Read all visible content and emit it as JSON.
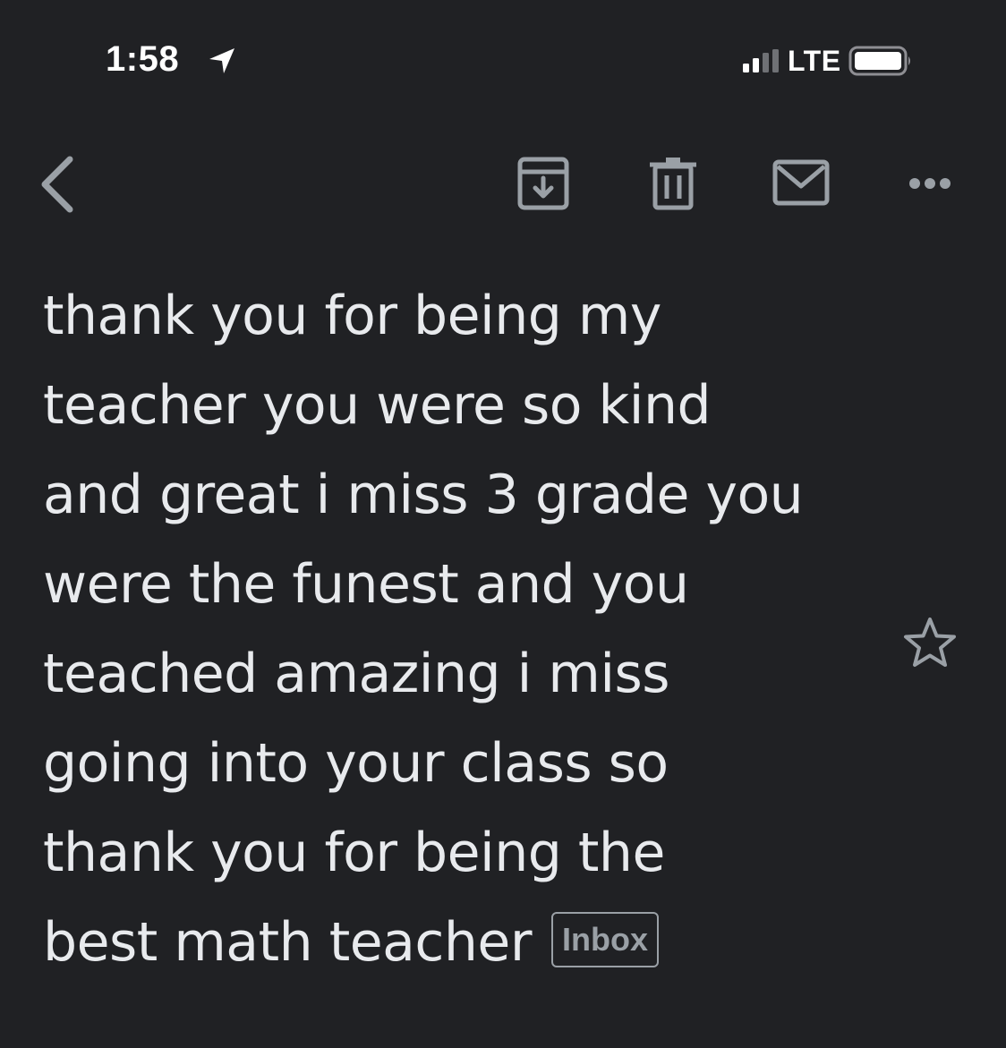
{
  "status_bar": {
    "time": "1:58",
    "network": "LTE",
    "icons": [
      "location-arrow-icon",
      "signal-bars-icon",
      "battery-icon"
    ]
  },
  "toolbar": {
    "icons": [
      "back-chevron-icon",
      "archive-icon",
      "trash-icon",
      "mail-icon",
      "more-dots-icon"
    ]
  },
  "message": {
    "lines": [
      "thank you for being my",
      "teacher you were so kind",
      "and great i miss 3 grade you",
      "were the funest and you",
      "teached amazing i miss",
      "going into your class so",
      "thank you for being the",
      "best math teacher"
    ],
    "label": "Inbox",
    "starred": false
  },
  "colors": {
    "background": "#202124",
    "text": "#e8eaed",
    "icon": "#9aa0a6"
  }
}
